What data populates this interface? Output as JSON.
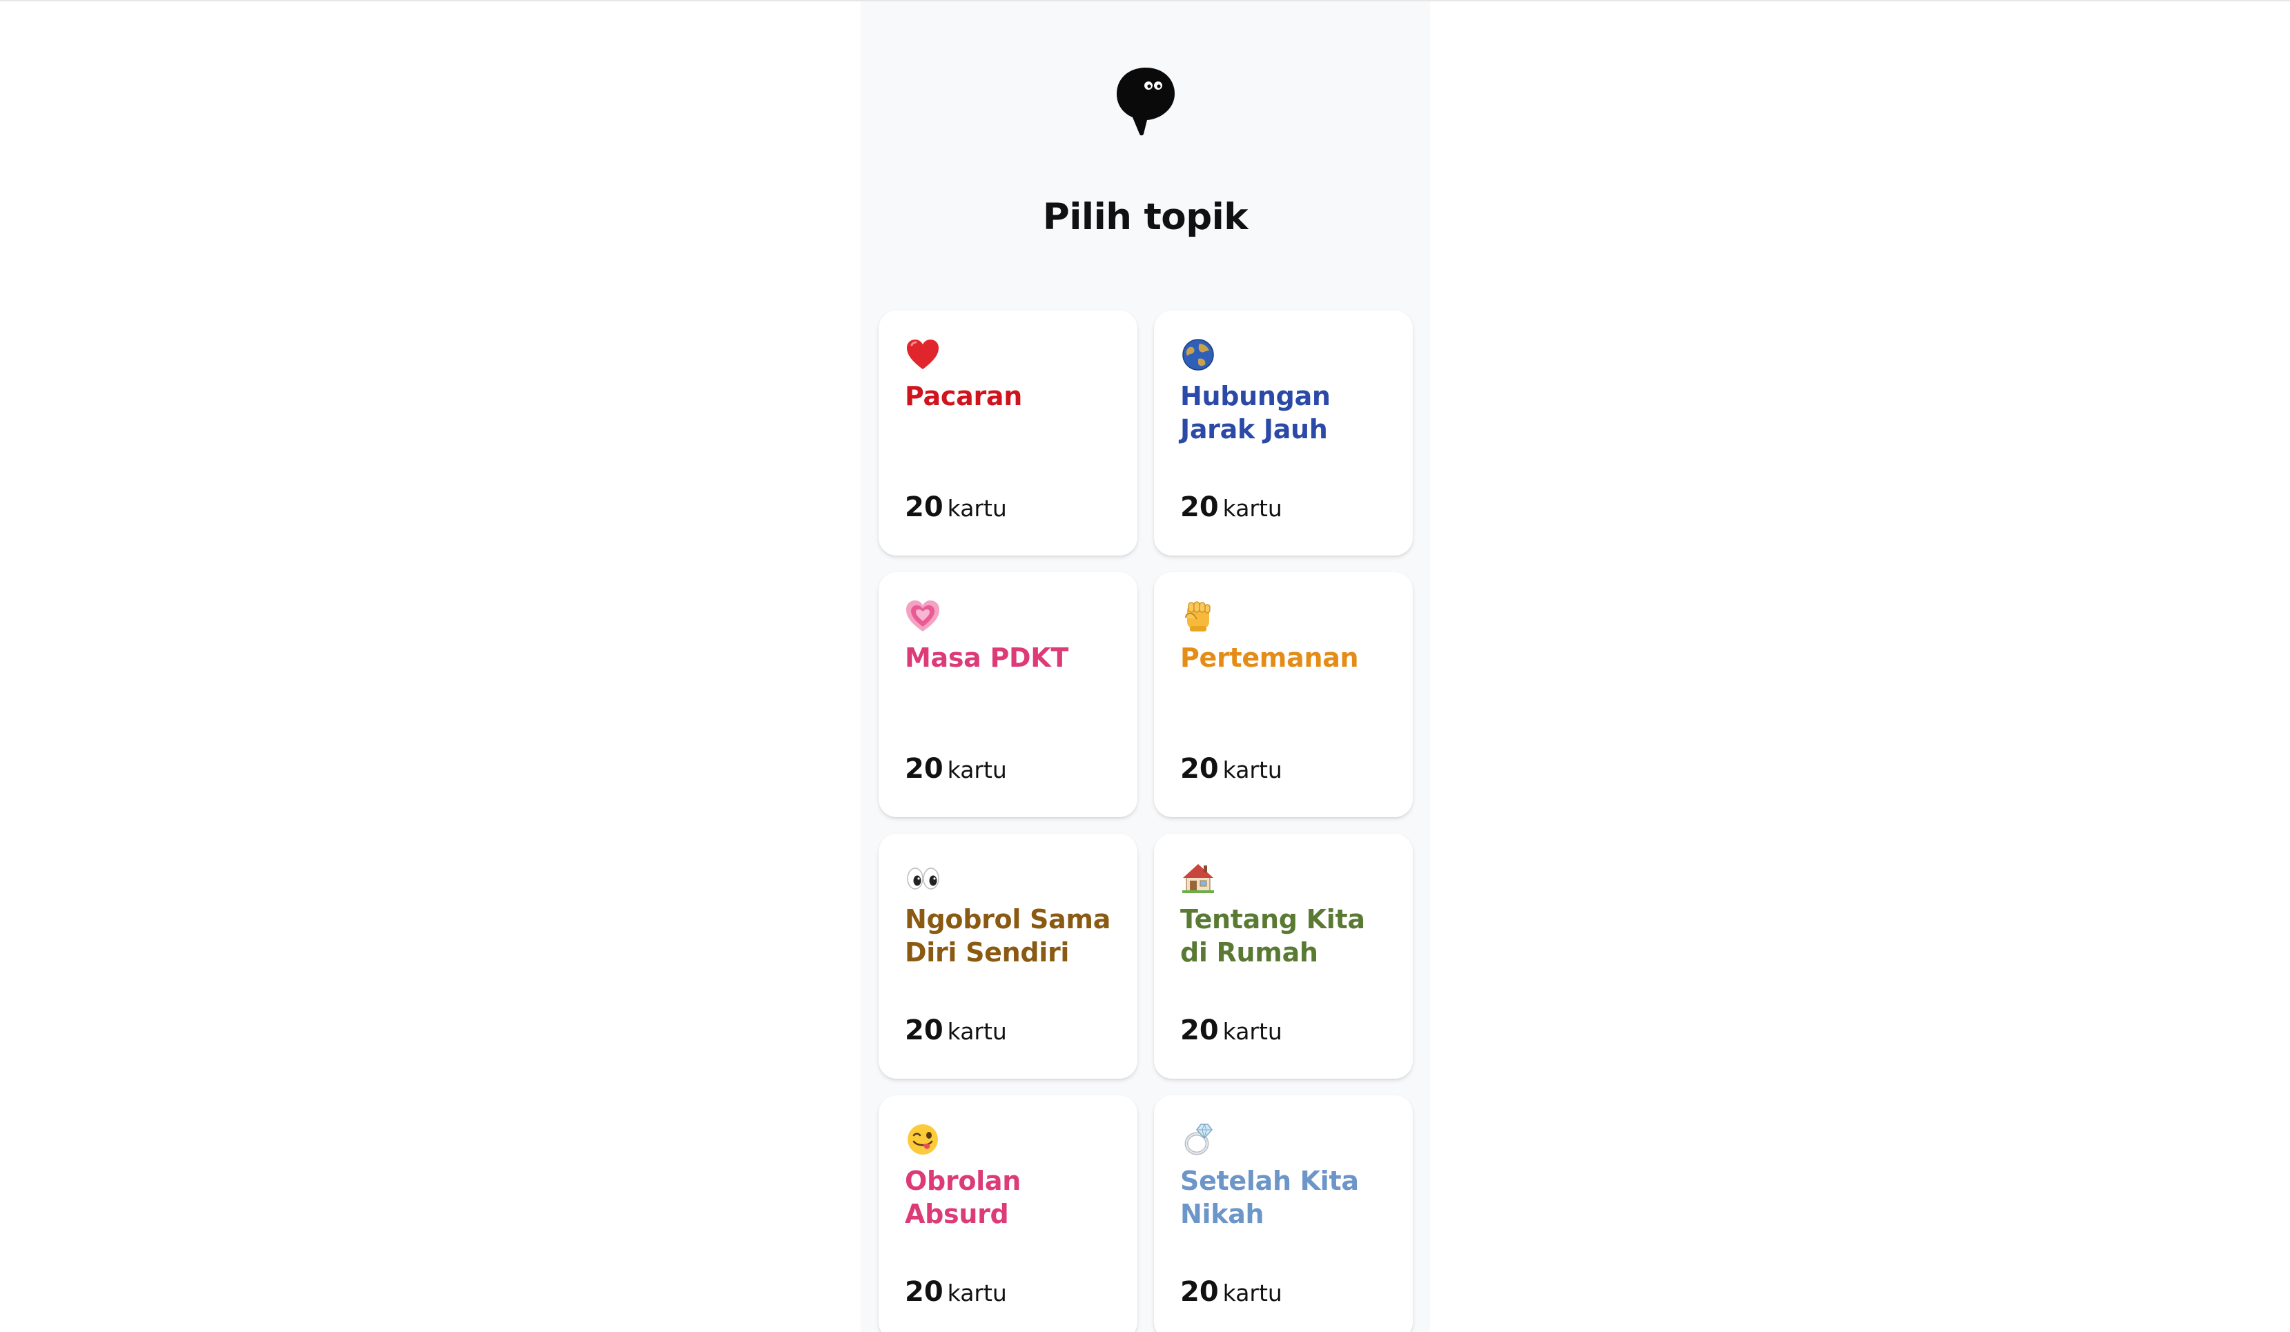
{
  "page": {
    "title": "Pilih topik",
    "logo_icon": "chat-bubble-eyes-icon"
  },
  "topics": [
    {
      "icon": "red-heart-icon",
      "title": "Pacaran",
      "count": "20",
      "unit": "kartu",
      "color": "#d0141e"
    },
    {
      "icon": "globe-icon",
      "title": "Hubungan Jarak Jauh",
      "count": "20",
      "unit": "kartu",
      "color": "#2b4aa8"
    },
    {
      "icon": "growing-heart-icon",
      "title": "Masa PDKT",
      "count": "20",
      "unit": "kartu",
      "color": "#dd3a78"
    },
    {
      "icon": "raised-fist-icon",
      "title": "Pertemanan",
      "count": "20",
      "unit": "kartu",
      "color": "#e58c17"
    },
    {
      "icon": "eyes-icon",
      "title": "Ngobrol Sama Diri Sendiri",
      "count": "20",
      "unit": "kartu",
      "color": "#8a5a12"
    },
    {
      "icon": "house-icon",
      "title": "Tentang Kita di Rumah",
      "count": "20",
      "unit": "kartu",
      "color": "#5a7a34"
    },
    {
      "icon": "winking-tongue-face-icon",
      "title": "Obrolan Absurd",
      "count": "20",
      "unit": "kartu",
      "color": "#dd3a78"
    },
    {
      "icon": "ring-icon",
      "title": "Setelah Kita Nikah",
      "count": "20",
      "unit": "kartu",
      "color": "#6c95c8"
    }
  ]
}
